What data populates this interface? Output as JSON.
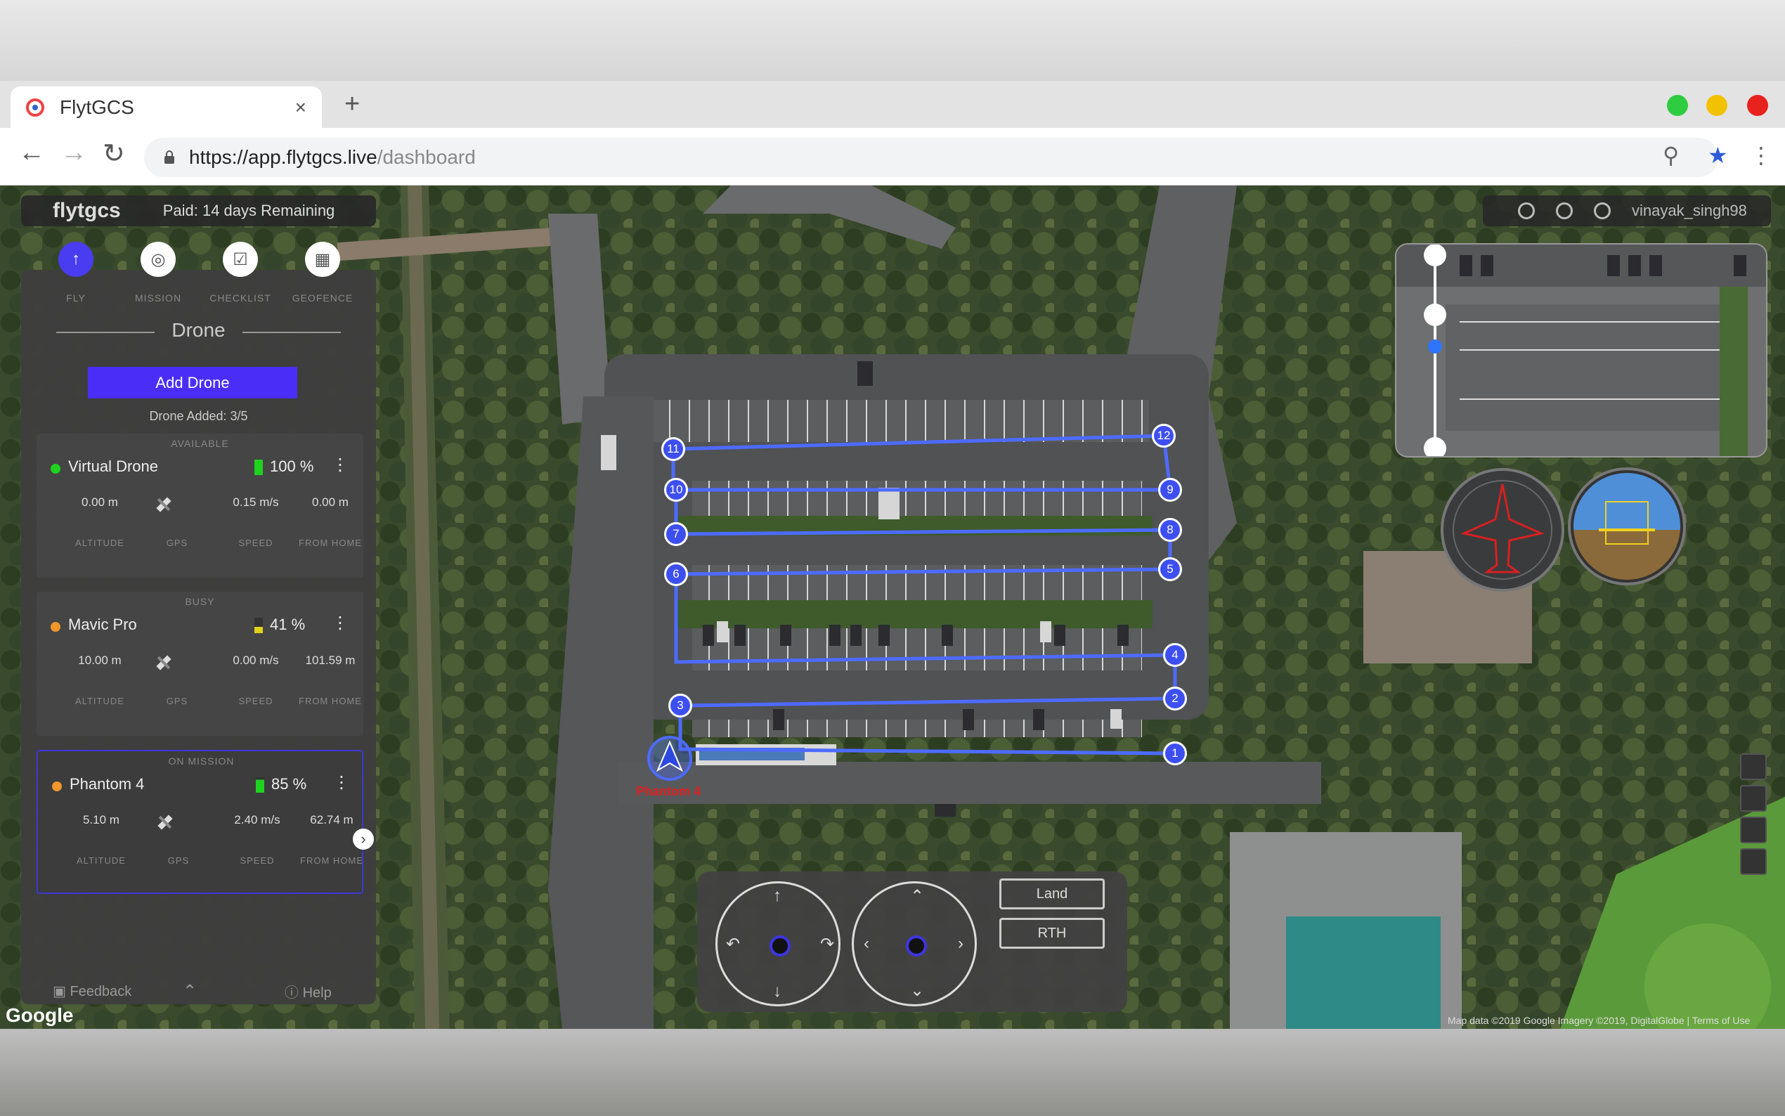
{
  "browser": {
    "tab_title": "FlytGCS",
    "tab_close": "×",
    "new_tab": "+",
    "url_host": "https://app.flytgcs.live",
    "url_path": "/dashboard"
  },
  "app": {
    "brand": "flytgcs",
    "paid_status": "Paid: 14 days Remaining",
    "username": "vinayak_singh98"
  },
  "modes": [
    {
      "label": "FLY",
      "icon": "arrow-up-icon"
    },
    {
      "label": "MISSION",
      "icon": "mission-icon"
    },
    {
      "label": "CHECKLIST",
      "icon": "checklist-icon"
    },
    {
      "label": "GEOFENCE",
      "icon": "geofence-icon"
    }
  ],
  "panel": {
    "title": "Drone",
    "add_drone": "Add Drone",
    "drone_added": "Drone Added: 3/5",
    "stat_labels": [
      "ALTITUDE",
      "GPS",
      "SPEED",
      "FROM HOME"
    ],
    "drones": [
      {
        "status": "AVAILABLE",
        "name": "Virtual Drone",
        "battery": "100 %",
        "battery_level": 1.0,
        "battery_color": "#1fd21f",
        "dot_color": "#1fd21f",
        "altitude": "0.00 m",
        "speed": "0.15 m/s",
        "from_home": "0.00 m",
        "more": "⋮"
      },
      {
        "status": "BUSY",
        "name": "Mavic Pro",
        "battery": "41 %",
        "battery_level": 0.41,
        "battery_color": "#e0d21a",
        "dot_color": "#f0962a",
        "altitude": "10.00 m",
        "speed": "0.00 m/s",
        "from_home": "101.59 m",
        "more": "⋮"
      },
      {
        "status": "ON MISSION",
        "name": "Phantom 4",
        "battery": "85 %",
        "battery_level": 0.85,
        "battery_color": "#1fd21f",
        "dot_color": "#f0962a",
        "altitude": "5.10 m",
        "speed": "2.40 m/s",
        "from_home": "62.74 m",
        "more": "⋮"
      }
    ],
    "feedback": "Feedback",
    "help": "Help"
  },
  "map": {
    "drone_label": "Phantom 4",
    "waypoints": [
      "1",
      "2",
      "3",
      "4",
      "5",
      "6",
      "7",
      "8",
      "9",
      "10",
      "11",
      "12"
    ],
    "google": "Google",
    "attribution": "Map data ©2019 Google Imagery ©2019, DigitalGlobe | Terms of Use"
  },
  "controls": {
    "land": "Land",
    "rth": "RTH"
  },
  "colors": {
    "accent": "#4a2ef8",
    "mission_path": "#4d6bff",
    "drone_label": "#e02020"
  }
}
